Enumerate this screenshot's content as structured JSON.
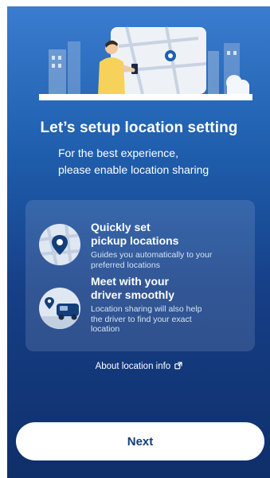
{
  "page": {
    "title": "Let’s setup location setting",
    "subtitle_line1": "For the best experience,",
    "subtitle_line2": "please enable location sharing"
  },
  "features": [
    {
      "heading_line1": "Quickly set",
      "heading_line2": "pickup locations",
      "description_line1": "Guides you automatically to your",
      "description_line2": "preferred locations",
      "icon": "map-pin-icon"
    },
    {
      "heading_line1": "Meet with your",
      "heading_line2": "driver smoothly",
      "description_line1": "Location sharing will also help",
      "description_line2": "the driver to find your exact",
      "description_line3": "location",
      "icon": "car-location-icon"
    }
  ],
  "about_link": {
    "label": "About location info",
    "icon": "external-link-icon"
  },
  "buttons": {
    "next_label": "Next"
  },
  "colors": {
    "accent": "#123f7a",
    "background_top": "#3a7ccf",
    "background_bottom": "#0f2f6a"
  }
}
